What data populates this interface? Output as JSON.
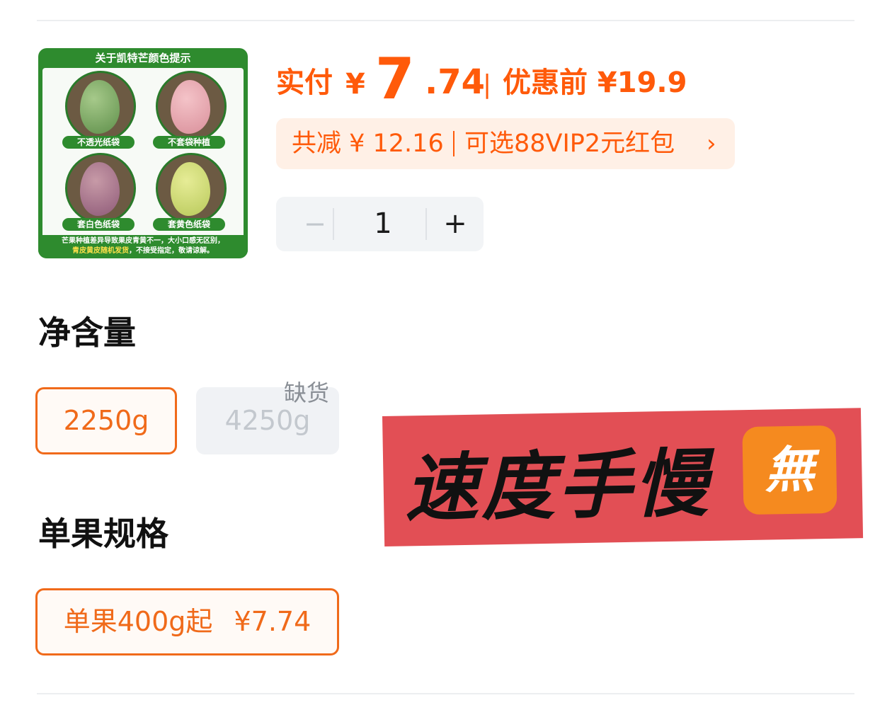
{
  "product_image": {
    "header": "关于凯特芒颜色提示",
    "cells": [
      {
        "label": "不透光纸袋"
      },
      {
        "label": "不套袋种植"
      },
      {
        "label": "套白色纸袋"
      },
      {
        "label": "套黄色纸袋"
      }
    ],
    "footer_line1": "芒果种植差异导致果皮青黄不一，大小口感无区别，",
    "footer_line2_highlight": "青皮黄皮随机发货",
    "footer_line2_rest": "，不接受指定，敬请谅解。"
  },
  "price": {
    "paid_label": "实付",
    "currency": "¥",
    "integer_part": "7",
    "decimal_part": ".74",
    "separator": "|",
    "before_label": "优惠前 ¥19.9"
  },
  "discount": {
    "total_text": "共减 ¥ 12.16",
    "option_text": "可选88VIP2元红包",
    "chevron": "›"
  },
  "quantity": {
    "minus": "−",
    "value": "1",
    "plus": "+"
  },
  "net_weight": {
    "title": "净含量",
    "options": [
      {
        "label": "2250g",
        "state": "selected"
      },
      {
        "label": "4250g",
        "state": "disabled",
        "tag": "缺货"
      }
    ]
  },
  "single_fruit": {
    "title": "单果规格",
    "options": [
      {
        "label": "单果400g起",
        "price": "¥7.74",
        "state": "selected"
      }
    ]
  },
  "banner": {
    "text": "速度手慢",
    "badge": "無"
  },
  "colors": {
    "accent": "#ff5a0a",
    "selected_border": "#f06a1a",
    "banner_bg": "#e24f55",
    "badge_bg": "#f58a1f"
  }
}
